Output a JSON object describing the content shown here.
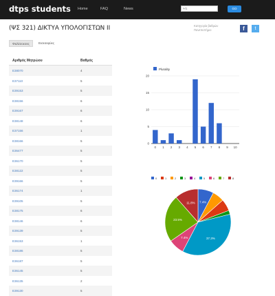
{
  "header": {
    "brand": "dtps students",
    "nav": [
      "Home",
      "FAQ",
      "News"
    ],
    "search_placeholder": "ΨΣ",
    "search_button": "GO"
  },
  "course": {
    "title": "(ΨΣ 321) ΔΙΚΤΥΑ ΥΠΟΛΟΓΙΣΤΩΝ ΙΙ",
    "source_line1": "Κατηγορία βαθμών",
    "source_line2": "Πανεπιστήμιο",
    "share": {
      "facebook_glyph": "f",
      "twitter_glyph": "t"
    }
  },
  "tabs": [
    {
      "label": "Φαλέσοεσες"
    },
    {
      "label": "Εισεσεφύες"
    }
  ],
  "table": {
    "headers": [
      "Αριθμός Μητρώου",
      "Βαθμός"
    ],
    "rows": [
      [
        "Ε38070",
        "4"
      ],
      [
        "Ε37110",
        "5"
      ],
      [
        "Ε39153",
        "5"
      ],
      [
        "Ε38156",
        "6"
      ],
      [
        "Ε39167",
        "6"
      ],
      [
        "Ε38148",
        "6"
      ],
      [
        "Ε37156",
        "1"
      ],
      [
        "Ε38166",
        "5"
      ],
      [
        "Ε36477",
        "5"
      ],
      [
        "Ε36170",
        "5"
      ],
      [
        "Ε38122",
        "5"
      ],
      [
        "Ε39166",
        "5"
      ],
      [
        "Ε36174",
        "1"
      ],
      [
        "Ε39105",
        "5"
      ],
      [
        "Ε38175",
        "6"
      ],
      [
        "Ε38146",
        "6"
      ],
      [
        "Ε39139",
        "5"
      ],
      [
        "Ε36153",
        "1"
      ],
      [
        "Ε38186",
        "5"
      ],
      [
        "Ε36187",
        "5"
      ],
      [
        "Ε36145",
        "5"
      ],
      [
        "Ε36135",
        "2"
      ],
      [
        "Ε39130",
        "5"
      ]
    ]
  },
  "chart_data": [
    {
      "type": "bar",
      "legend": [
        "Plurality"
      ],
      "legend_position": "top-left",
      "categories": [
        "0",
        "1",
        "2",
        "3",
        "4",
        "5",
        "6",
        "7",
        "8",
        "9",
        "10"
      ],
      "series": [
        {
          "name": "Plurality",
          "values": [
            4,
            1,
            3,
            1,
            0,
            19,
            5,
            12,
            6,
            0,
            0
          ]
        }
      ],
      "y_ticks": [
        "0",
        "5",
        "10",
        "15",
        "20"
      ],
      "ylim": [
        0,
        20
      ],
      "grid": true,
      "colors": {
        "bar": "#3366cc",
        "grid": "#e6e6e6",
        "axis": "#333333"
      }
    },
    {
      "type": "pie",
      "legend_position": "top",
      "slices": [
        {
          "label": "0",
          "value": 4,
          "color": "#3366cc",
          "text": "7.4%"
        },
        {
          "label": "1",
          "value": 3,
          "color": "#ff9900",
          "text": ""
        },
        {
          "label": "2",
          "value": 3,
          "color": "#dc3912",
          "text": ""
        },
        {
          "label": "3",
          "value": 1,
          "color": "#109618",
          "text": ""
        },
        {
          "label": "4",
          "value": 19,
          "color": "#0099c6",
          "text": "37.3%"
        },
        {
          "label": "5",
          "value": 4,
          "color": "#dd4477",
          "text": "7.4%"
        },
        {
          "label": "6",
          "value": 12,
          "color": "#66aa00",
          "text": "23.5%"
        },
        {
          "label": "7",
          "value": 6,
          "color": "#b82e2e",
          "text": "11.8%"
        }
      ],
      "legend": [
        {
          "label": "0",
          "color": "#3366cc"
        },
        {
          "label": "1",
          "color": "#dc3912"
        },
        {
          "label": "2",
          "color": "#ff9900"
        },
        {
          "label": "3",
          "color": "#109618"
        },
        {
          "label": "4",
          "color": "#990099"
        },
        {
          "label": "5",
          "color": "#0099c6"
        },
        {
          "label": "6",
          "color": "#dd4477"
        },
        {
          "label": "7",
          "color": "#66aa00"
        },
        {
          "label": "8",
          "color": "#b82e2e"
        }
      ]
    }
  ]
}
